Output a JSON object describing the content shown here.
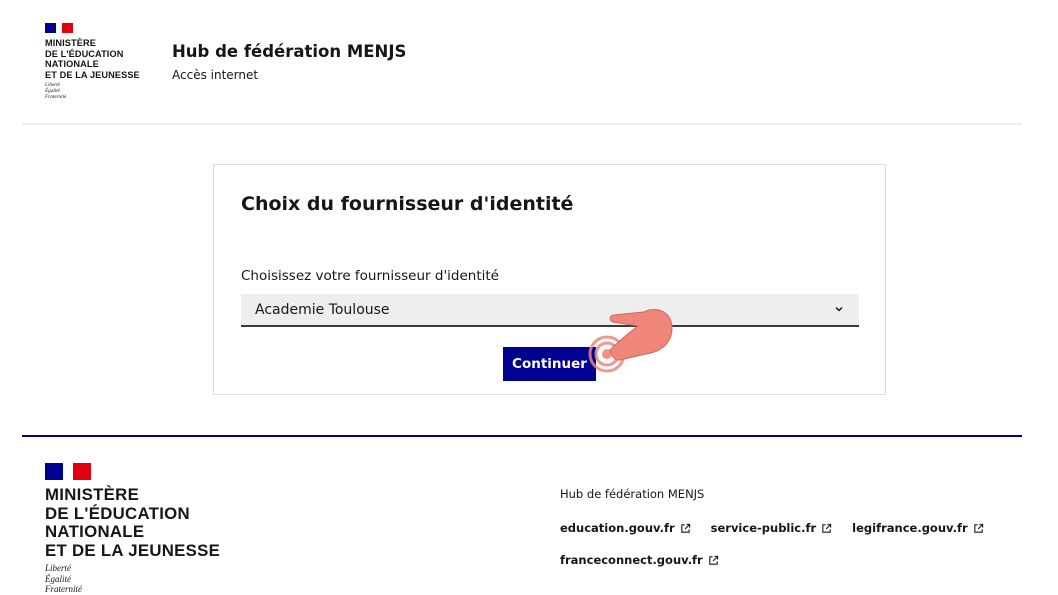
{
  "header": {
    "ministry_lines": [
      "MINISTÈRE",
      "DE L'ÉDUCATION",
      "NATIONALE",
      "ET DE LA JEUNESSE"
    ],
    "motto_lines": [
      "Liberté",
      "Égalité",
      "Fraternité"
    ],
    "service_title": "Hub de fédération MENJS",
    "service_tagline": "Accès internet"
  },
  "card": {
    "title": "Choix du fournisseur d'identité",
    "select_label": "Choisissez votre fournisseur d'identité",
    "select_value": "Academie Toulouse",
    "continue_label": "Continuer"
  },
  "footer": {
    "ministry_lines": [
      "MINISTÈRE",
      "DE L'ÉDUCATION",
      "NATIONALE",
      "ET DE LA JEUNESSE"
    ],
    "motto_lines": [
      "Liberté",
      "Égalité",
      "Fraternité"
    ],
    "description": "Hub de fédération MENJS",
    "links": [
      {
        "label": "education.gouv.fr"
      },
      {
        "label": "service-public.fr"
      },
      {
        "label": "legifrance.gouv.fr"
      },
      {
        "label": "franceconnect.gouv.fr"
      }
    ]
  },
  "icons": {
    "select_arrow": "chevron-down-icon",
    "external_link": "external-link-icon",
    "pointer": "hand-pointer-icon"
  },
  "colors": {
    "primary": "#000091",
    "flag_red": "#e1000f",
    "text": "#161616",
    "select_bg": "#eeeeee",
    "pointer": "#f0857a"
  }
}
